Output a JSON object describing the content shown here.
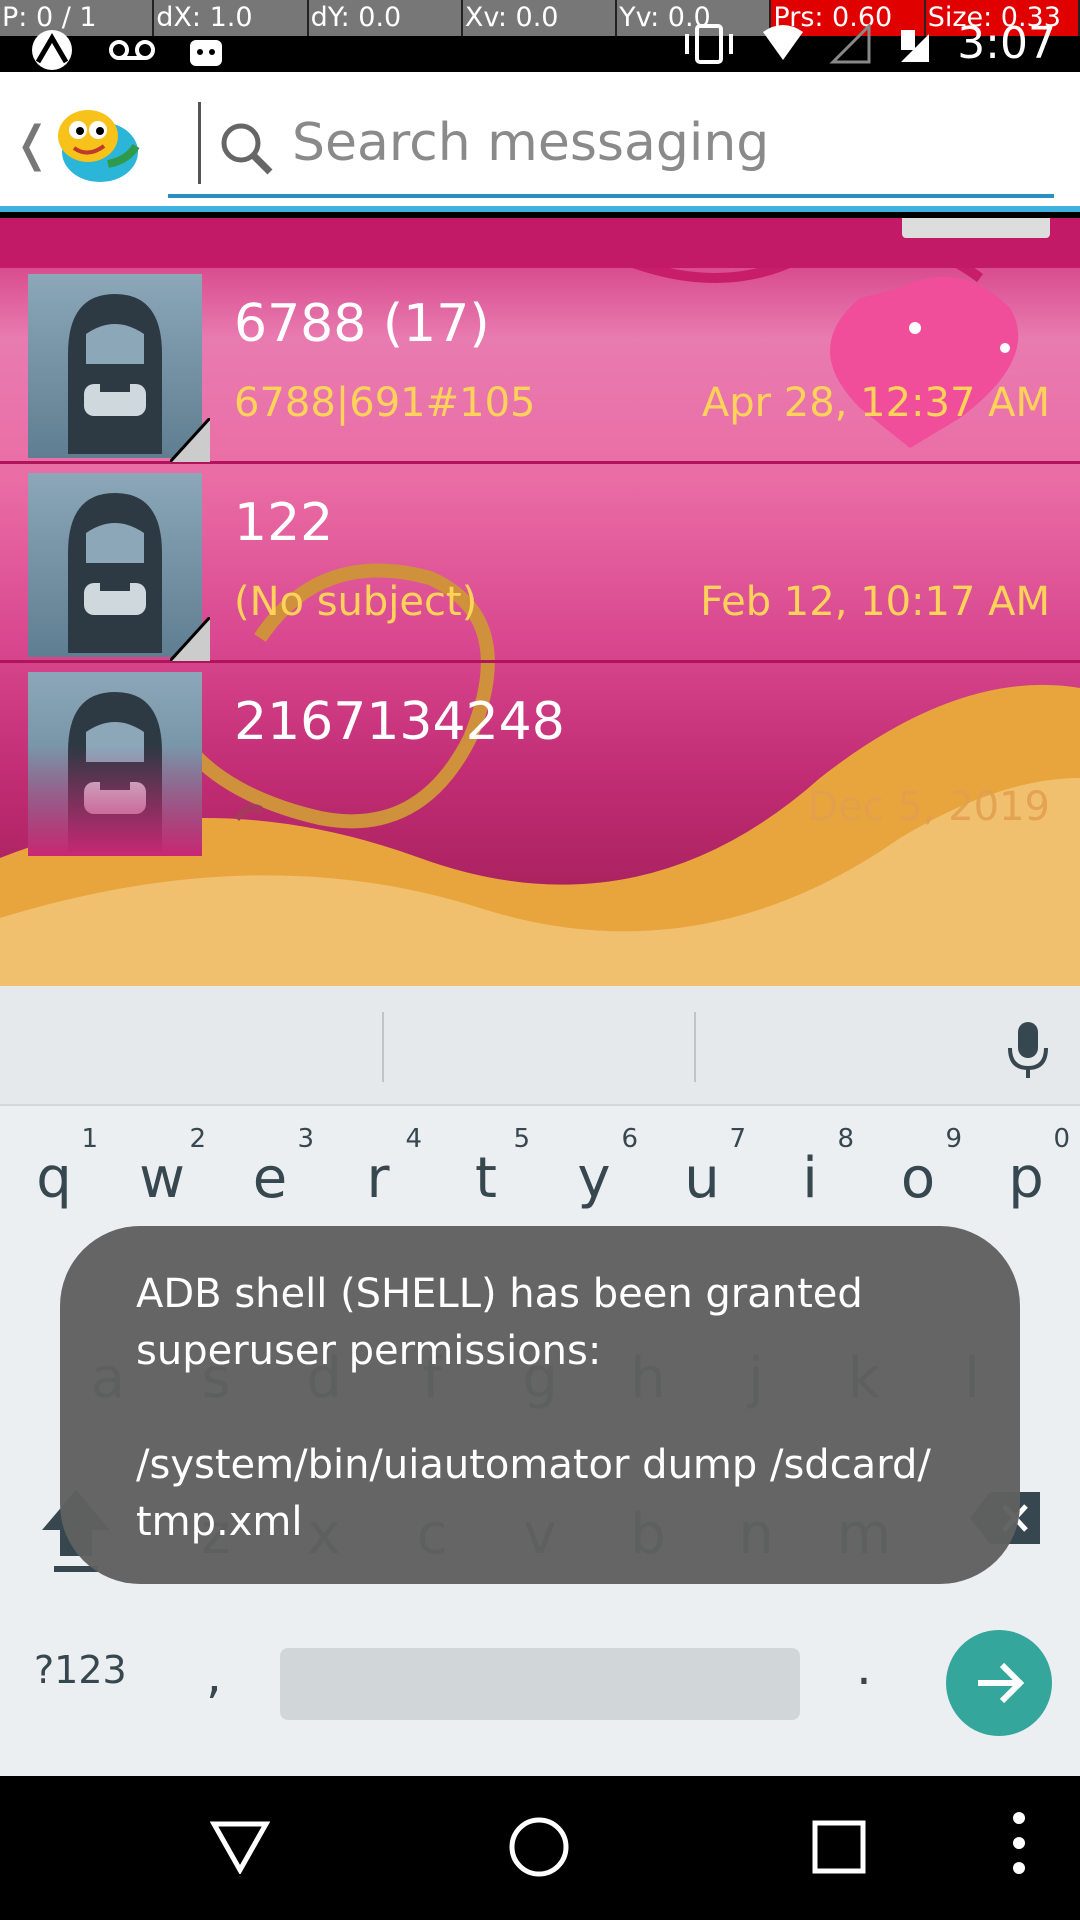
{
  "debug_overlay": {
    "p": "P: 0 / 1",
    "dx": "dX: 1.0",
    "dy": "dY: 0.0",
    "xv": "Xv: 0.0",
    "yv": "Yv: 0.0",
    "prs": "Prs: 0.60",
    "size": "Size: 0.33"
  },
  "status_bar": {
    "time": "3:07"
  },
  "app_bar": {
    "back_glyph": "❬",
    "search_placeholder": "Search messaging"
  },
  "conversations": [
    {
      "name": "6788 (17)",
      "snippet": "6788|691#105",
      "date": "Apr 28, 12:37 AM"
    },
    {
      "name": "122",
      "snippet": "(No subject)",
      "date": "Feb 12, 10:17 AM"
    },
    {
      "name": "2167134248",
      "snippet": "",
      "date": "Dec 5, 2019"
    }
  ],
  "keyboard": {
    "row1": [
      {
        "l": "q",
        "n": "1"
      },
      {
        "l": "w",
        "n": "2"
      },
      {
        "l": "e",
        "n": "3"
      },
      {
        "l": "r",
        "n": "4"
      },
      {
        "l": "t",
        "n": "5"
      },
      {
        "l": "y",
        "n": "6"
      },
      {
        "l": "u",
        "n": "7"
      },
      {
        "l": "i",
        "n": "8"
      },
      {
        "l": "o",
        "n": "9"
      },
      {
        "l": "p",
        "n": "0"
      }
    ],
    "row2": [
      "a",
      "s",
      "d",
      "f",
      "g",
      "h",
      "j",
      "k",
      "l"
    ],
    "row3": [
      "z",
      "x",
      "c",
      "v",
      "b",
      "n",
      "m"
    ],
    "symbols_label": "?123",
    "comma": ",",
    "period": "."
  },
  "toast": {
    "line1": "ADB shell (SHELL) has been granted",
    "line2": "superuser permissions:",
    "line3": "/system/bin/uiautomator dump /sdcard/",
    "line4": "tmp.xml"
  },
  "colors": {
    "accent": "#3fb3e0",
    "go_button": "#34a69c",
    "date_text": "#ffd35a",
    "toast_bg": "#606060"
  }
}
